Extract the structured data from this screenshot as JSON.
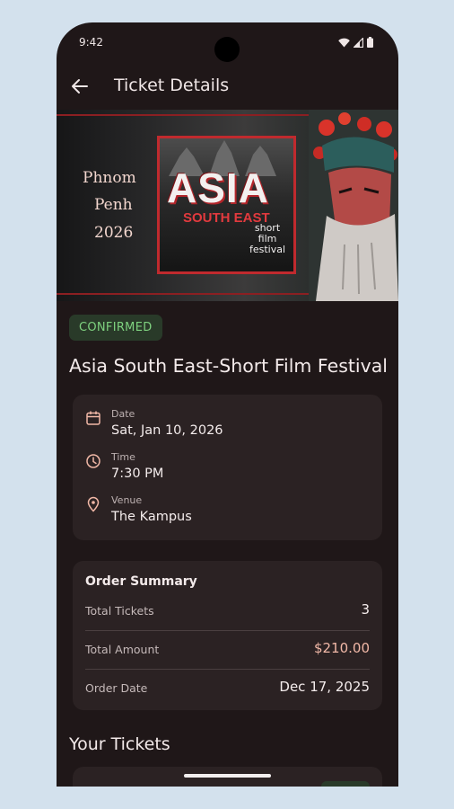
{
  "status_bar": {
    "time": "9:42"
  },
  "app_bar": {
    "title": "Ticket Details",
    "back_icon": "arrow-back-icon"
  },
  "banner": {
    "city_line1": "Phnom",
    "city_line2": "Penh",
    "year": "2026",
    "poster_title": "ASIA",
    "poster_subtitle": "SOUTH EAST",
    "poster_tag_1": "short",
    "poster_tag_2": "film",
    "poster_tag_3": "festival"
  },
  "event": {
    "status": "CONFIRMED",
    "name": "Asia South East-Short Film Festival"
  },
  "details": [
    {
      "icon": "calendar-icon",
      "label": "Date",
      "value": "Sat, Jan 10, 2026"
    },
    {
      "icon": "clock-icon",
      "label": "Time",
      "value": "7:30 PM"
    },
    {
      "icon": "location-pin-icon",
      "label": "Venue",
      "value": "The Kampus"
    }
  ],
  "order_summary": {
    "title": "Order Summary",
    "rows": [
      {
        "label": "Total Tickets",
        "value": "3"
      },
      {
        "label": "Total Amount",
        "value": "$210.00"
      },
      {
        "label": "Order Date",
        "value": "Dec 17, 2025"
      }
    ]
  },
  "tickets_section": {
    "title": "Your Tickets"
  },
  "colors": {
    "background": "#1f1718",
    "card": "#2b2223",
    "confirmed_badge_bg": "#293a29",
    "confirmed_badge_text": "#7ed17f",
    "accent_amount": "#f1b8a7",
    "icon_accent": "#f1b8a7"
  }
}
